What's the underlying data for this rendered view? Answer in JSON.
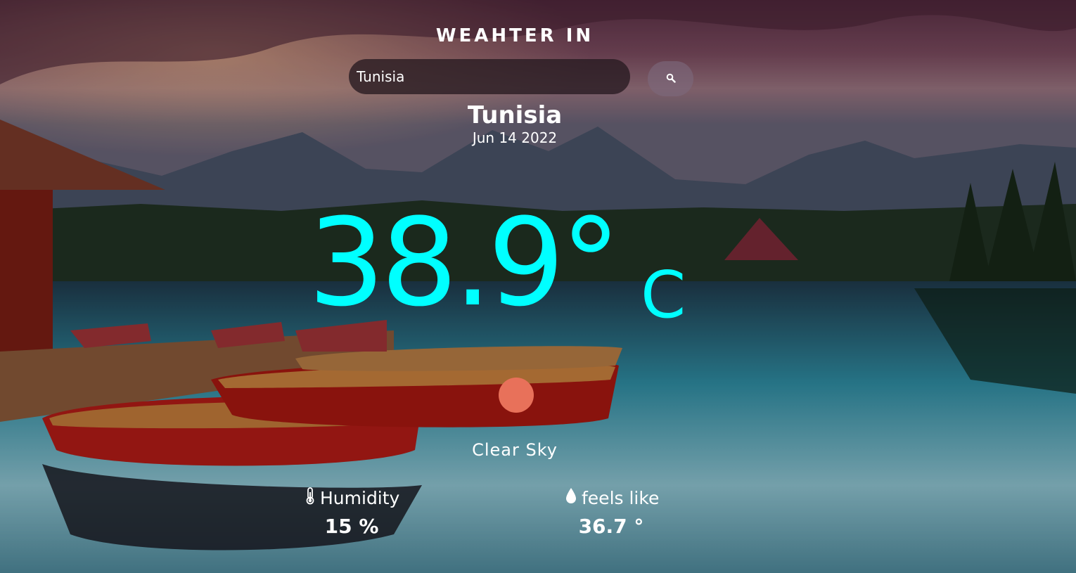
{
  "header": {
    "title": "WEAHTER IN"
  },
  "search": {
    "value": "Tunisia",
    "button_icon": "search-icon"
  },
  "location": {
    "city": "Tunisia",
    "date": "Jun 14 2022"
  },
  "temperature": {
    "value": "38.9°",
    "unit": "C",
    "color": "#00ffff"
  },
  "condition": {
    "icon": "sun-icon",
    "icon_color": "#e8715a",
    "description": "Clear Sky"
  },
  "stats": {
    "humidity": {
      "icon": "thermometer-icon",
      "label": "Humidity",
      "value": "15 %"
    },
    "feels_like": {
      "icon": "water-drop-icon",
      "label": "feels like",
      "value": "36.7 °"
    }
  }
}
